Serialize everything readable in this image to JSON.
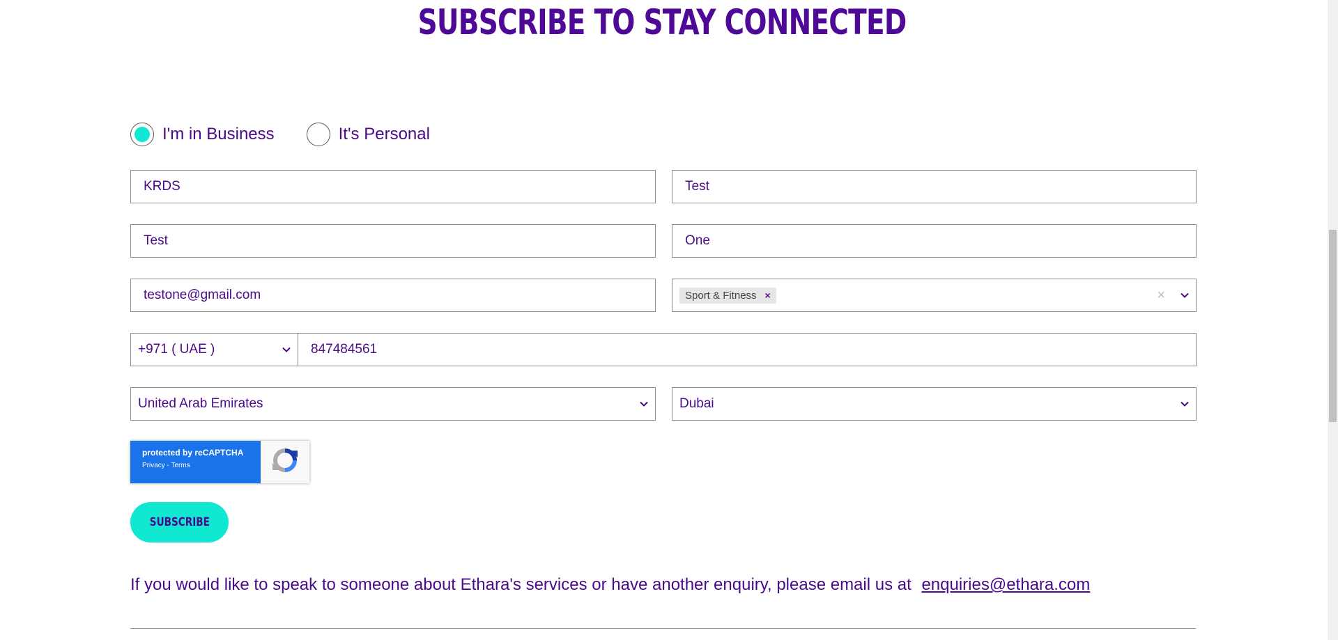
{
  "page": {
    "title": "SUBSCRIBE TO STAY CONNECTED"
  },
  "account_type": {
    "options": [
      {
        "label": "I'm in Business",
        "selected": true
      },
      {
        "label": "It's Personal",
        "selected": false
      }
    ]
  },
  "form": {
    "company": "KRDS",
    "job_title": "Test",
    "first_name": "Test",
    "last_name": "One",
    "email": "testone@gmail.com",
    "interests": [
      "Sport & Fitness"
    ],
    "phone_code": "+971 ( UAE )",
    "phone_number": "847484561",
    "country": "United Arab Emirates",
    "city": "Dubai"
  },
  "recaptcha": {
    "line1": "protected by reCAPTCHA",
    "line2": "Privacy - Terms"
  },
  "subscribe_label": "SUBSCRIBE",
  "enquiry": {
    "text": "If you would like to speak to someone about Ethara's services or have another enquiry, please email us at",
    "email": "enquiries@ethara.com"
  },
  "colors": {
    "brand_purple": "#4b0a8c",
    "accent_cyan": "#11e8d2",
    "recaptcha_blue": "#1a73e8"
  }
}
